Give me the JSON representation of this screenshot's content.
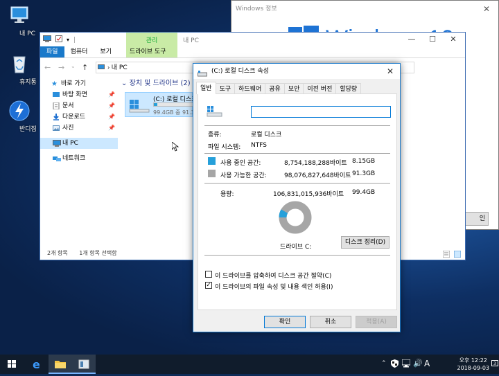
{
  "desktop": {
    "icons": [
      {
        "label": "내 PC",
        "icon": "computer-icon"
      },
      {
        "label": "휴지통",
        "icon": "recycle-bin-icon"
      },
      {
        "label": "반디집",
        "icon": "bandizip-icon"
      }
    ]
  },
  "about_window": {
    "title": "Windows 정보",
    "banner": "Windows 10",
    "ok_label": "인"
  },
  "explorer": {
    "context_tab_label": "관리",
    "title": "내 PC",
    "tabs": [
      "파일",
      "컴퓨터",
      "보기"
    ],
    "drive_tools_tab": "드라이브 도구",
    "address": "내 PC",
    "nav": {
      "quick_access": "바로 가기",
      "items": [
        "바탕 화면",
        "문서",
        "다운로드",
        "사진"
      ],
      "this_pc": "내 PC",
      "network": "네트워크"
    },
    "section_header": "장치 및 드라이브 (2)",
    "drive": {
      "name": "(C:) 로컬 디스크",
      "free_text": "99.4GB 중 91.3GB",
      "used_fraction": 0.08
    },
    "status_items": "2개 항목",
    "status_selected": "1개 항목 선택함"
  },
  "properties": {
    "title": "(C:) 로컬 디스크 속성",
    "tabs": [
      "일반",
      "도구",
      "하드웨어",
      "공유",
      "보안",
      "이전 버전",
      "할당량"
    ],
    "name_value": "",
    "type_label": "종류:",
    "type_value": "로컬 디스크",
    "fs_label": "파일 시스템:",
    "fs_value": "NTFS",
    "used_label": "사용 중인 공간:",
    "used_bytes": "8,754,188,288바이트",
    "used_gb": "8.15GB",
    "free_label": "사용 가능한 공간:",
    "free_bytes": "98,076,827,648바이트",
    "free_gb": "91.3GB",
    "capacity_label": "용량:",
    "capacity_bytes": "106,831,015,936바이트",
    "capacity_gb": "99.4GB",
    "drive_label": "드라이브 C:",
    "cleanup_button": "디스크 정리(D)",
    "compress_label": "이 드라이브를 압축하여 디스크 공간 절약(C)",
    "compress_checked": false,
    "index_label": "이 드라이브의 파일 속성 및 내용 색인 허용(I)",
    "index_checked": true,
    "ok_button": "확인",
    "cancel_button": "취소",
    "apply_button": "적용(A)",
    "used_color": "#26a0da",
    "free_color": "#a6a6a6"
  },
  "taskbar": {
    "ime_indicator": "A",
    "time_period": "오후 12:22",
    "date": "2018-09-03"
  }
}
